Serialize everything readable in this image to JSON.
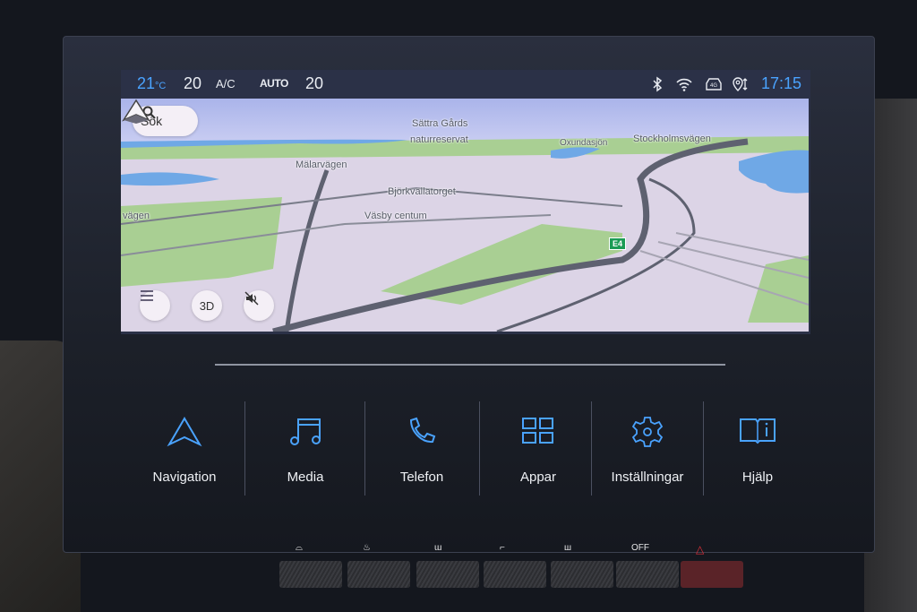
{
  "status_bar": {
    "temperature_left": "21",
    "temperature_unit": "°C",
    "fan_left": "20",
    "ac_label": "A/C",
    "auto_label": "AUTO",
    "fan_right": "20",
    "icons": [
      "bluetooth-icon",
      "wifi-icon",
      "4g-car-icon",
      "location-sync-icon"
    ],
    "time": "17:15",
    "accent_color": "#4aa3ff"
  },
  "map": {
    "search_label": "Sök",
    "labels": {
      "sattra": "Sättra Gårds",
      "naturreservat": "naturreservat",
      "oxundasjon": "Oxundasjön",
      "stockholmsvagen": "Stockholmsvägen",
      "malarvagen": "Mälarvägen",
      "bjorkvallatorget": "Björkvallatorget",
      "vasby_centrum": "Väsby centum",
      "vagen": "vägen"
    },
    "road_shield": "E4",
    "controls": {
      "menu_icon": "menu-icon",
      "view_mode": "3D",
      "mute_icon": "sound-muted-icon"
    }
  },
  "home_tiles": [
    {
      "label": "Navigation",
      "icon": "navigation-arrow-icon"
    },
    {
      "label": "Media",
      "icon": "music-note-icon"
    },
    {
      "label": "Telefon",
      "icon": "phone-icon"
    },
    {
      "label": "Appar",
      "icon": "apps-grid-icon"
    },
    {
      "label": "Inställningar",
      "icon": "gear-icon"
    },
    {
      "label": "Hjälp",
      "icon": "help-book-icon"
    }
  ],
  "hardware_buttons": [
    {
      "icon": "front-defrost-icon",
      "glyph": "⌓"
    },
    {
      "icon": "seat-heat-icon",
      "glyph": "♨"
    },
    {
      "icon": "windshield-defrost-icon",
      "glyph": "ɯ"
    },
    {
      "icon": "rear-defrost-icon",
      "glyph": "⌐"
    },
    {
      "icon": "rear-window-heat-icon",
      "glyph": "ш"
    },
    {
      "icon": "climate-off-label",
      "glyph": "OFF"
    },
    {
      "icon": "hazard-icon",
      "glyph": "△"
    }
  ]
}
